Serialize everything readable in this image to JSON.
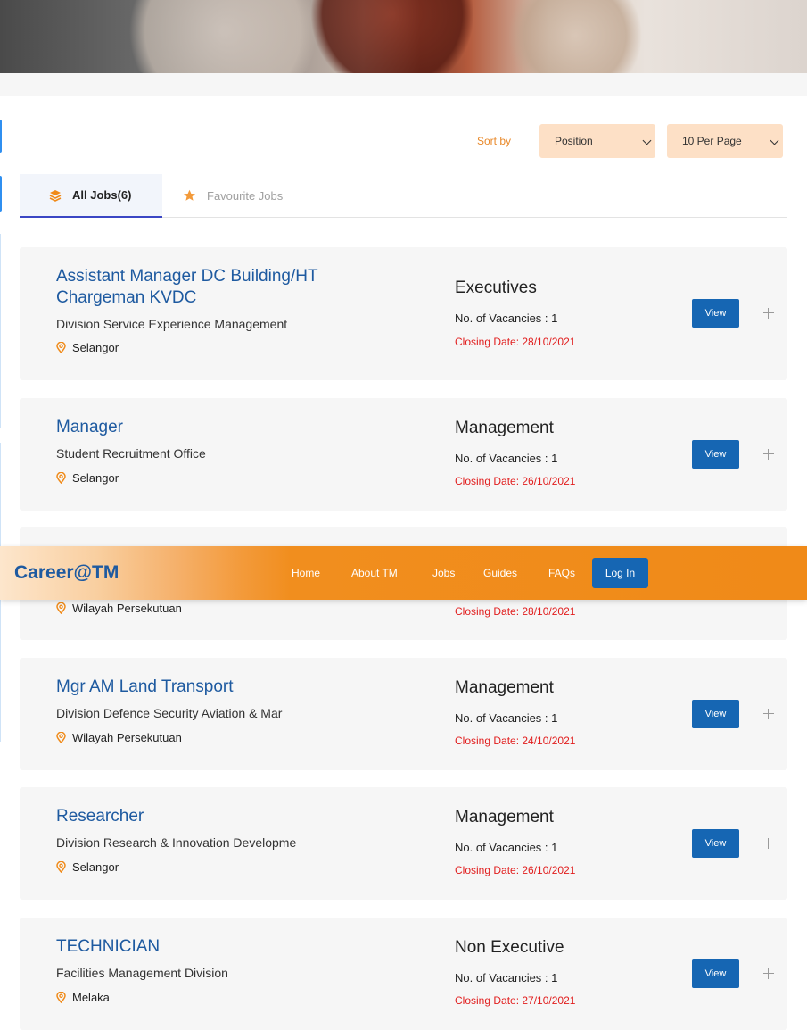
{
  "sort": {
    "label": "Sort by",
    "order_value": "Position",
    "per_page_value": "10 Per Page"
  },
  "tabs": {
    "all": "All Jobs(6)",
    "favourite": "Favourite Jobs"
  },
  "jobs": [
    {
      "title": "Assistant Manager DC Building/HT Chargeman KVDC",
      "division": "Division Service Experience Management",
      "location": "Selangor",
      "level": "Executives",
      "vacancies": "No. of Vacancies : 1",
      "closing": "Closing Date: 28/10/2021",
      "view": "View"
    },
    {
      "title": "Manager",
      "division": "Student Recruitment Office",
      "location": "Selangor",
      "level": "Management",
      "vacancies": "No. of Vacancies : 1",
      "closing": "Closing Date: 26/10/2021",
      "view": "View"
    },
    {
      "location": "Wilayah Persekutuan",
      "closing": "Closing Date: 28/10/2021"
    },
    {
      "title": "Mgr AM Land Transport",
      "division": "Division Defence Security Aviation & Mar",
      "location": "Wilayah Persekutuan",
      "level": "Management",
      "vacancies": "No. of Vacancies : 1",
      "closing": "Closing Date: 24/10/2021",
      "view": "View"
    },
    {
      "title": "Researcher",
      "division": "Division Research & Innovation Developme",
      "location": "Selangor",
      "level": "Management",
      "vacancies": "No. of Vacancies : 1",
      "closing": "Closing Date: 26/10/2021",
      "view": "View"
    },
    {
      "title": "TECHNICIAN",
      "division": "Facilities Management Division",
      "location": "Melaka",
      "level": "Non Executive",
      "vacancies": "No. of Vacancies : 1",
      "closing": "Closing Date: 27/10/2021",
      "view": "View"
    }
  ],
  "navbar": {
    "brand": "Career@TM",
    "links": [
      "Home",
      "About TM",
      "Jobs",
      "Guides",
      "FAQs"
    ],
    "login": "Log In"
  },
  "colors": {
    "brand_blue": "#1e5aa0",
    "button_blue": "#1666b3",
    "accent_orange": "#f08a18",
    "closing_red": "#e11d1d"
  },
  "icons": {
    "all_jobs": "layers-icon",
    "favourite": "star-icon",
    "location": "map-pin-icon",
    "expand": "plus-icon"
  }
}
